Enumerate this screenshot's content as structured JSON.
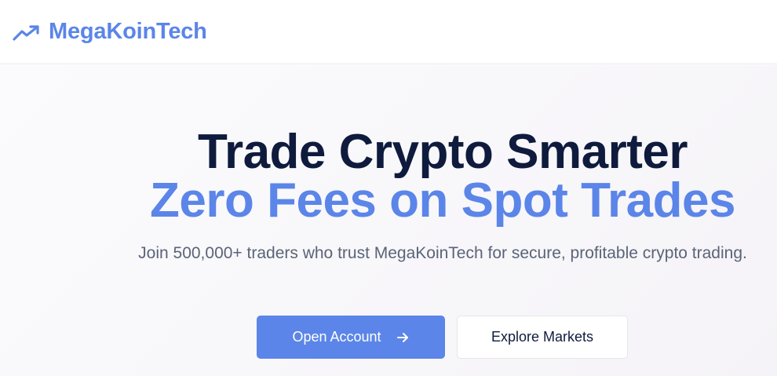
{
  "brand": {
    "name": "MegaKoinTech",
    "icon": "trending-up-icon",
    "color": "#5b85e8"
  },
  "hero": {
    "title_line1": "Trade Crypto Smarter",
    "title_line2": "Zero Fees on Spot Trades",
    "subtitle": "Join 500,000+ traders who trust MegaKoinTech for secure, profitable crypto trading."
  },
  "cta": {
    "primary_label": "Open Account",
    "primary_icon": "arrow-right-icon",
    "secondary_label": "Explore Markets"
  },
  "colors": {
    "accent": "#5b85e8",
    "heading": "#0f1b3d",
    "muted_text": "#5a6478"
  }
}
